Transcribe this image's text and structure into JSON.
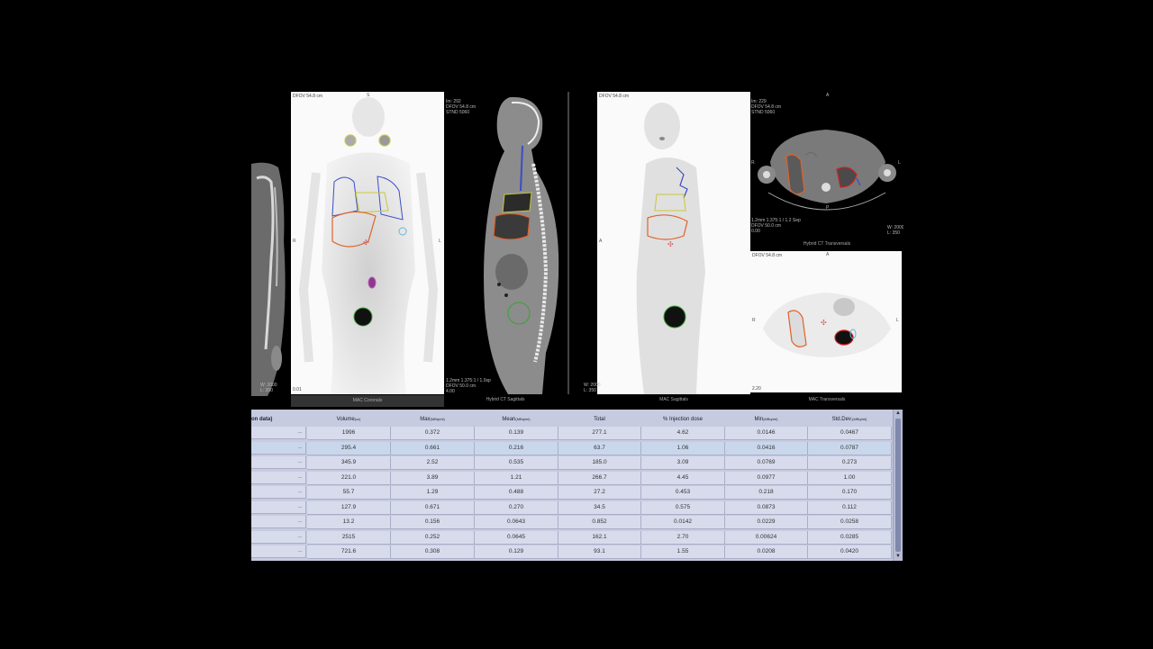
{
  "viewports": {
    "coronal_mip": {
      "info_top": "DFOV 54.8 cm",
      "info_bottom": "W: 2000\nL: 350",
      "label_left": "R",
      "label_right": "L",
      "label_top": "S",
      "caption": "MAC Coronals",
      "scale_tick": "0.01"
    },
    "sagittal_ct": {
      "info_top": "Im: 292\nDFOV 54.8 cm\nSTND 5060",
      "info_bottom": "1.2mm 1.375:1 / 1.0sp\nDFOV 50.0 cm\n4.00",
      "caption": "Hybrid CT Sagittals"
    },
    "sagittal_mip": {
      "info_top": "DFOV 54.8 cm",
      "info_bottom": "W: 2000\nL: 350",
      "label_left": "A",
      "caption": "MAC Sagittals"
    },
    "transverse_ct": {
      "info_top": "Im: 229\nDFOV 54.8 cm\nSTND 5060",
      "info_bottom": "1.2mm 1.375:1 / 1.2 Sep\nDFOV 50.0 cm\n0.00",
      "info_right": "W: 2000\nL: 350",
      "label_top": "A",
      "label_left": "R",
      "label_right": "L",
      "label_bottom": "P",
      "caption": "Hybrid CT Transversals"
    },
    "transverse_mip": {
      "info_top": "DFOV 54.8 cm",
      "label_top": "A",
      "label_left": "R",
      "label_right": "L",
      "caption": "MAC Transversals",
      "scale_tick": "2.20"
    }
  },
  "table": {
    "columns": [
      {
        "label": "on data)"
      },
      {
        "label": "Volume",
        "unit": "(cc)"
      },
      {
        "label": "Max",
        "unit": "(MBq/ml)"
      },
      {
        "label": "Mean",
        "unit": "(MBq/ml)"
      },
      {
        "label": "Total",
        "unit": ""
      },
      {
        "label": "% Injection dose",
        "unit": ""
      },
      {
        "label": "Min",
        "unit": "(MBq/ml)"
      },
      {
        "label": "Std.Dev.",
        "unit": "(MBq/ml)"
      }
    ],
    "rows": [
      {
        "name": "--",
        "cells": [
          "1996",
          "0.372",
          "0.139",
          "277.1",
          "4.62",
          "0.0146",
          "0.0467"
        ]
      },
      {
        "name": "--",
        "cells": [
          "295.4",
          "0.661",
          "0.216",
          "63.7",
          "1.06",
          "0.0416",
          "0.0787"
        ],
        "selected": true
      },
      {
        "name": "--",
        "cells": [
          "345.9",
          "2.52",
          "0.535",
          "185.0",
          "3.09",
          "0.0769",
          "0.273"
        ]
      },
      {
        "name": "--",
        "cells": [
          "221.0",
          "3.89",
          "1.21",
          "266.7",
          "4.45",
          "0.0977",
          "1.00"
        ]
      },
      {
        "name": "--",
        "cells": [
          "55.7",
          "1.29",
          "0.488",
          "27.2",
          "0.453",
          "0.218",
          "0.170"
        ]
      },
      {
        "name": "--",
        "cells": [
          "127.9",
          "0.671",
          "0.270",
          "34.5",
          "0.575",
          "0.0873",
          "0.112"
        ]
      },
      {
        "name": "--",
        "cells": [
          "13.2",
          "0.156",
          "0.0643",
          "0.852",
          "0.0142",
          "0.0229",
          "0.0258"
        ]
      },
      {
        "name": "--",
        "cells": [
          "2515",
          "0.252",
          "0.0645",
          "162.1",
          "2.70",
          "0.00624",
          "0.0285"
        ]
      },
      {
        "name": "--",
        "cells": [
          "721.6",
          "0.308",
          "0.129",
          "93.1",
          "1.55",
          "0.0208",
          "0.0420"
        ]
      }
    ]
  },
  "scrollbar": {
    "up_arrow": "▲",
    "down_arrow": "▼"
  },
  "colors": {
    "table_bg": "#c6cbe0",
    "cell_bg": "#d7dbec",
    "selected_row": "#c9d7ec",
    "roi_orange": "#e0622a",
    "roi_blue": "#3a4cc8",
    "roi_yellow": "#c8c83a",
    "roi_green": "#3aa03a",
    "roi_red": "#d02020"
  }
}
